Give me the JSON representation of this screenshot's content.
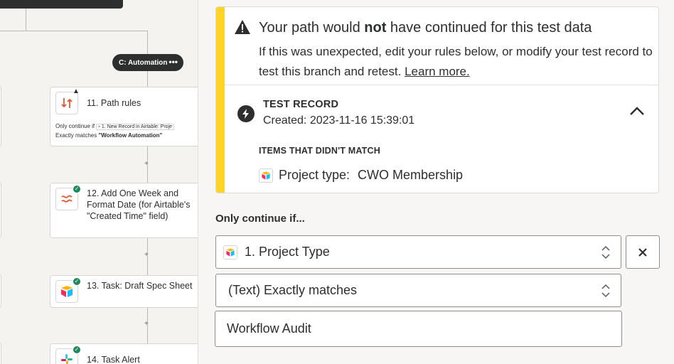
{
  "canvas": {
    "path_pill": {
      "label": "C: Automation",
      "menu": "•••"
    },
    "steps": [
      {
        "number_title": "11. Path rules",
        "status": "warning",
        "condition_prefix": "Only continue if",
        "condition_chip": "1. New Record in Airtable: Proje",
        "condition_rule": "Exactly matches",
        "condition_value": "\"Workflow Automation\""
      },
      {
        "number_title": "12. Add One Week and Format Date (for Airtable's \"Created Time\" field)",
        "status": "success"
      },
      {
        "number_title": "13. Task: Draft Spec Sheet",
        "status": "success"
      },
      {
        "number_title": "14. Task Alert",
        "status": "success"
      }
    ],
    "plus_symbol": "+"
  },
  "panel": {
    "warning": {
      "title_before": "Your path would ",
      "title_bold": "not",
      "title_after": " have continued for this test data",
      "body": "If this was unexpected, edit your rules below, or modify your test record to test this branch and retest.",
      "link": "Learn more."
    },
    "test_record": {
      "label": "TEST RECORD",
      "created": "Created: 2023-11-16 15:39:01",
      "items_label": "ITEMS THAT DIDN'T MATCH",
      "item_field": "Project type:",
      "item_value": "CWO Membership"
    },
    "only_continue_label": "Only continue if...",
    "rule": {
      "field": "1. Project Type",
      "operator": "(Text) Exactly matches",
      "value": "Workflow Audit"
    }
  },
  "colors": {
    "warning_stripe": "#ffd427",
    "success": "#1c8a5c",
    "dark": "#2d2e2e"
  }
}
